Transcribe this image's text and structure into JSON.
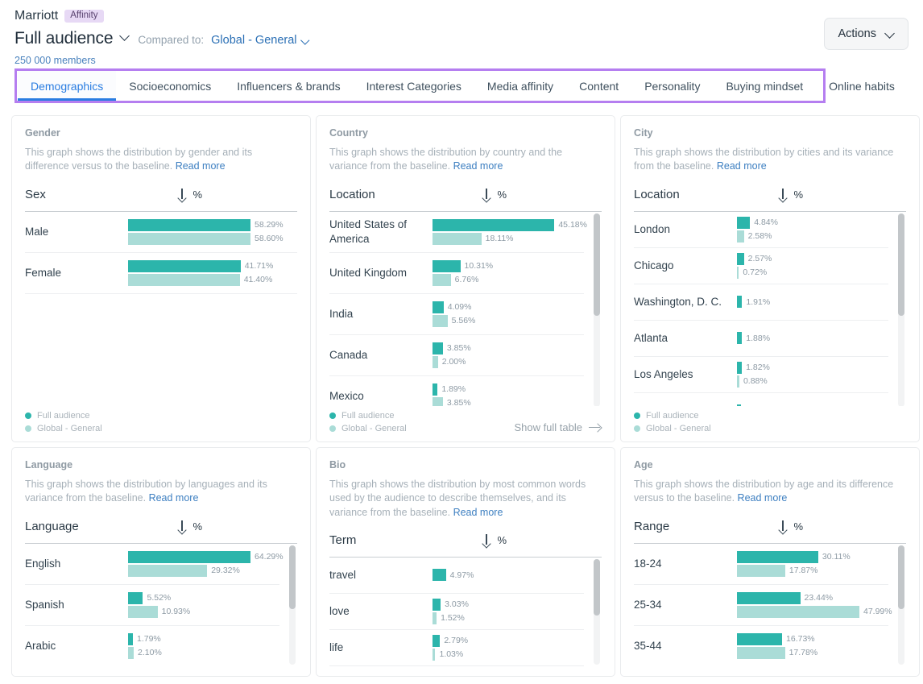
{
  "header": {
    "brand": "Marriott",
    "brand_tag": "Affinity",
    "audience_title": "Full audience",
    "compared_label": "Compared to:",
    "compared_value": "Global - General",
    "members": "250 000 members",
    "actions_label": "Actions"
  },
  "tabs": [
    {
      "label": "Demographics",
      "active": true
    },
    {
      "label": "Socioeconomics",
      "active": false
    },
    {
      "label": "Influencers & brands",
      "active": false
    },
    {
      "label": "Interest Categories",
      "active": false
    },
    {
      "label": "Media affinity",
      "active": false
    },
    {
      "label": "Content",
      "active": false
    },
    {
      "label": "Personality",
      "active": false
    },
    {
      "label": "Buying mindset",
      "active": false
    },
    {
      "label": "Online habits",
      "active": false
    }
  ],
  "legend": {
    "full": "Full audience",
    "baseline": "Global - General"
  },
  "common": {
    "read_more": "Read more",
    "show_full_table": "Show full table",
    "pct": "%"
  },
  "chart_data": [
    {
      "type": "bar",
      "id": "gender",
      "title": "Gender",
      "description": "This graph shows the distribution by gender and its difference versus to the baseline.",
      "column_label": "Sex",
      "categories": [
        "Male",
        "Female"
      ],
      "series": [
        {
          "name": "Full audience",
          "color": "#2cb5ab",
          "values": [
            58.29,
            41.71
          ]
        },
        {
          "name": "Global - General",
          "color": "#aadcd7",
          "values": [
            58.6,
            41.4
          ]
        }
      ],
      "value_labels": [
        [
          "58.29%",
          "58.60%"
        ],
        [
          "41.71%",
          "41.40%"
        ]
      ],
      "ylabel": "%",
      "xlabel": "",
      "has_scrollbar": false,
      "has_show_full_table": false
    },
    {
      "type": "bar",
      "id": "country",
      "title": "Country",
      "description": "This graph shows the distribution by country and the variance from the baseline.",
      "column_label": "Location",
      "categories": [
        "United States of America",
        "United Kingdom",
        "India",
        "Canada",
        "Mexico"
      ],
      "series": [
        {
          "name": "Full audience",
          "color": "#2cb5ab",
          "values": [
            45.18,
            10.31,
            4.09,
            3.85,
            1.89
          ]
        },
        {
          "name": "Global - General",
          "color": "#aadcd7",
          "values": [
            18.11,
            6.76,
            5.56,
            2.0,
            3.85
          ]
        }
      ],
      "value_labels": [
        [
          "45.18%",
          "18.11%"
        ],
        [
          "10.31%",
          "6.76%"
        ],
        [
          "4.09%",
          "5.56%"
        ],
        [
          "3.85%",
          "2.00%"
        ],
        [
          "1.89%",
          "3.85%"
        ]
      ],
      "ylabel": "%",
      "xlabel": "",
      "has_scrollbar": true,
      "has_show_full_table": true
    },
    {
      "type": "bar",
      "id": "city",
      "title": "City",
      "description": "This graph shows the distribution by cities and its variance from the baseline.",
      "column_label": "Location",
      "categories": [
        "London",
        "Chicago",
        "Washington, D. C.",
        "Atlanta",
        "Los Angeles",
        ""
      ],
      "series": [
        {
          "name": "Full audience",
          "color": "#2cb5ab",
          "values": [
            4.84,
            2.57,
            1.91,
            1.88,
            1.82,
            1.45
          ]
        },
        {
          "name": "Global - General",
          "color": "#aadcd7",
          "values": [
            2.58,
            0.72,
            0,
            0,
            0.88,
            0
          ]
        }
      ],
      "value_labels": [
        [
          "4.84%",
          "2.58%"
        ],
        [
          "2.57%",
          "0.72%"
        ],
        [
          "1.91%",
          ""
        ],
        [
          "1.88%",
          ""
        ],
        [
          "1.82%",
          "0.88%"
        ],
        [
          "",
          ""
        ]
      ],
      "ylabel": "%",
      "xlabel": "",
      "has_scrollbar": true,
      "has_show_full_table": false
    },
    {
      "type": "bar",
      "id": "language",
      "title": "Language",
      "description": "This graph shows the distribution by languages and its variance from the baseline.",
      "column_label": "Language",
      "categories": [
        "English",
        "Spanish",
        "Arabic"
      ],
      "series": [
        {
          "name": "Full audience",
          "color": "#2cb5ab",
          "values": [
            64.29,
            5.52,
            1.79
          ]
        },
        {
          "name": "Global - General",
          "color": "#aadcd7",
          "values": [
            29.32,
            10.93,
            2.1
          ]
        }
      ],
      "value_labels": [
        [
          "64.29%",
          "29.32%"
        ],
        [
          "5.52%",
          "10.93%"
        ],
        [
          "1.79%",
          "2.10%"
        ]
      ],
      "ylabel": "%",
      "xlabel": "",
      "has_scrollbar": true,
      "has_show_full_table": false
    },
    {
      "type": "bar",
      "id": "bio",
      "title": "Bio",
      "description": "This graph shows the distribution by most common words used by the audience to describe themselves, and its variance from the baseline.",
      "column_label": "Term",
      "categories": [
        "travel",
        "love",
        "life"
      ],
      "series": [
        {
          "name": "Full audience",
          "color": "#2cb5ab",
          "values": [
            4.97,
            3.03,
            2.79
          ]
        },
        {
          "name": "Global - General",
          "color": "#aadcd7",
          "values": [
            0,
            1.52,
            1.03
          ]
        }
      ],
      "value_labels": [
        [
          "4.97%",
          ""
        ],
        [
          "3.03%",
          "1.52%"
        ],
        [
          "2.79%",
          "1.03%"
        ]
      ],
      "ylabel": "%",
      "xlabel": "",
      "has_scrollbar": true,
      "has_show_full_table": false
    },
    {
      "type": "bar",
      "id": "age",
      "title": "Age",
      "description": "This graph shows the distribution by age and its difference versus to the baseline.",
      "column_label": "Range",
      "categories": [
        "18-24",
        "25-34",
        "35-44"
      ],
      "series": [
        {
          "name": "Full audience",
          "color": "#2cb5ab",
          "values": [
            30.11,
            23.44,
            16.73
          ]
        },
        {
          "name": "Global - General",
          "color": "#aadcd7",
          "values": [
            17.87,
            47.99,
            17.78
          ]
        }
      ],
      "value_labels": [
        [
          "30.11%",
          "17.87%"
        ],
        [
          "23.44%",
          "47.99%"
        ],
        [
          "16.73%",
          "17.78%"
        ]
      ],
      "ylabel": "%",
      "xlabel": "",
      "has_scrollbar": true,
      "has_show_full_table": false
    }
  ]
}
